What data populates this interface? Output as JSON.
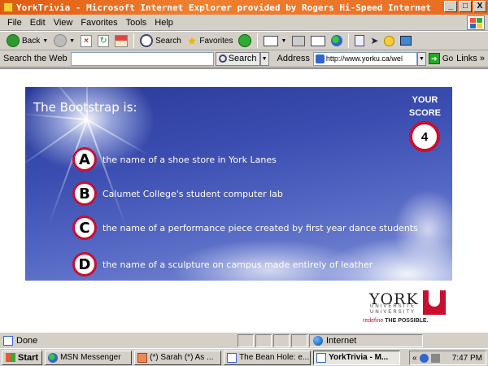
{
  "window": {
    "title": "YorkTrivia - Microsoft Internet Explorer provided by Rogers Hi-Speed Internet",
    "buttons": [
      "_",
      "□",
      "X"
    ]
  },
  "menu": [
    "File",
    "Edit",
    "View",
    "Favorites",
    "Tools",
    "Help"
  ],
  "toolbar": {
    "back": "Back",
    "search": "Search",
    "favorites": "Favorites"
  },
  "addressbar": {
    "search_label": "Search the Web",
    "search_button": "Search",
    "address_label": "Address",
    "url": "http://www.yorku.ca/wel",
    "go_label": "Go",
    "links_label": "Links"
  },
  "quiz": {
    "question": "The Bootstrap is:",
    "score_label_1": "YOUR",
    "score_label_2": "SCORE",
    "score": "4",
    "answers": [
      {
        "letter": "A",
        "text": "the name of a shoe store in York Lanes"
      },
      {
        "letter": "B",
        "text": "Calumet College's student computer lab"
      },
      {
        "letter": "C",
        "text": "the name of a performance piece created by first year dance students"
      },
      {
        "letter": "D",
        "text": "the name of a sculpture on campus made entirely of leather"
      }
    ]
  },
  "york": {
    "name": "YORK",
    "university_top": "UNIVERSITÉ",
    "university_bottom": "UNIVERSITY",
    "tag_redefine": "redefine",
    "tag_possible": "THE POSSIBLE."
  },
  "status": {
    "text": "Done",
    "zone": "Internet"
  },
  "taskbar": {
    "start": "Start",
    "tasks": [
      {
        "label": "MSN Messenger",
        "active": false
      },
      {
        "label": "(*) Sarah (*) As ...",
        "active": false
      },
      {
        "label": "The Bean Hole: e...",
        "active": false
      },
      {
        "label": "YorkTrivia - M...",
        "active": true
      }
    ],
    "chevron": "«",
    "clock": "7:47 PM"
  }
}
